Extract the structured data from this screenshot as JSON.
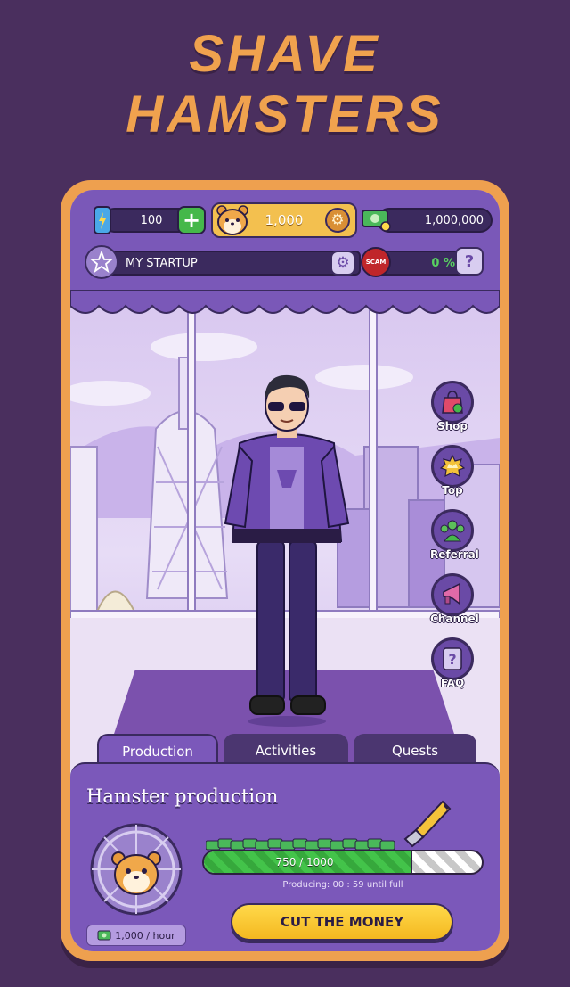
{
  "banner": {
    "line1": "SHAVE",
    "line2": "HAMSTERS"
  },
  "header": {
    "energy": "100",
    "coins": "1,000",
    "cash": "1,000,000",
    "startup_name": "MY STARTUP",
    "scam_badge": "SCAM",
    "scam_percent": "0 %",
    "help": "?"
  },
  "side_menu": [
    {
      "label": "Shop",
      "icon": "shop-bag-icon"
    },
    {
      "label": "Top",
      "icon": "crown-icon"
    },
    {
      "label": "Referral",
      "icon": "group-icon"
    },
    {
      "label": "Channel",
      "icon": "megaphone-icon"
    },
    {
      "label": "FAQ",
      "icon": "question-icon"
    }
  ],
  "tabs": [
    "Production",
    "Activities",
    "Quests"
  ],
  "active_tab": "Production",
  "production": {
    "title": "Hamster production",
    "progress_text": "750 / 1000",
    "progress_value": 0.75,
    "producing_text": "Producing: 00 : 59 until full",
    "cut_button": "CUT THE MONEY",
    "rate": "1,000 / hour"
  },
  "colors": {
    "accent": "#eea04f",
    "panel": "#7b58ba",
    "background": "#4a2f5e",
    "progress": "#43c34a",
    "button": "#ffd94a"
  }
}
